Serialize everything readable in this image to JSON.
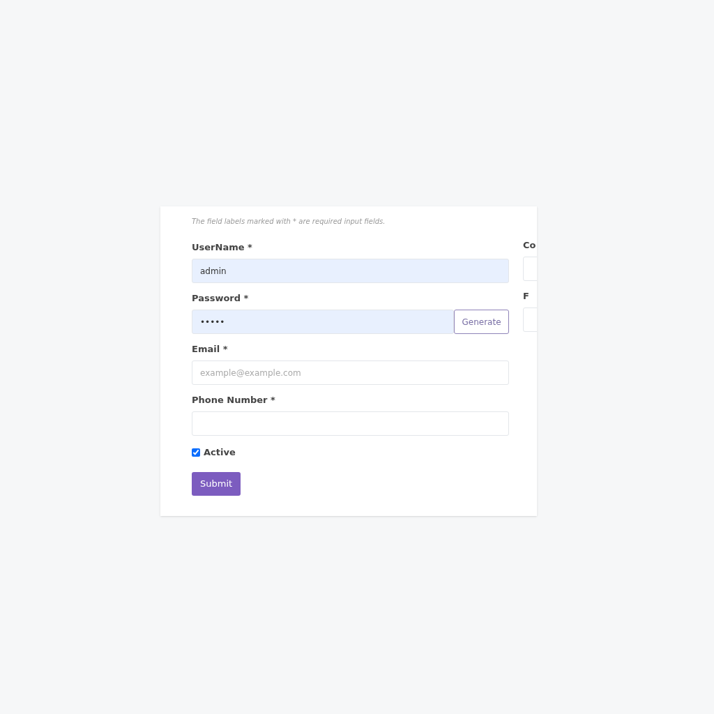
{
  "note": "The field labels marked with * are required input fields.",
  "fields": [
    {
      "label": "UserName *",
      "value": "admin",
      "autofilled": true
    },
    {
      "label": "Password *",
      "value": "•••••",
      "autofilled": true,
      "button": "Generate"
    },
    {
      "label": "Email *",
      "placeholder": "example@example.com",
      "autofilled": false
    },
    {
      "label": "Phone Number *",
      "autofilled": false
    }
  ],
  "active": {
    "label": "Active",
    "checked": true
  },
  "submit": "Submit",
  "right_column": [
    {
      "label": "Co"
    },
    {
      "label": "F"
    }
  ]
}
